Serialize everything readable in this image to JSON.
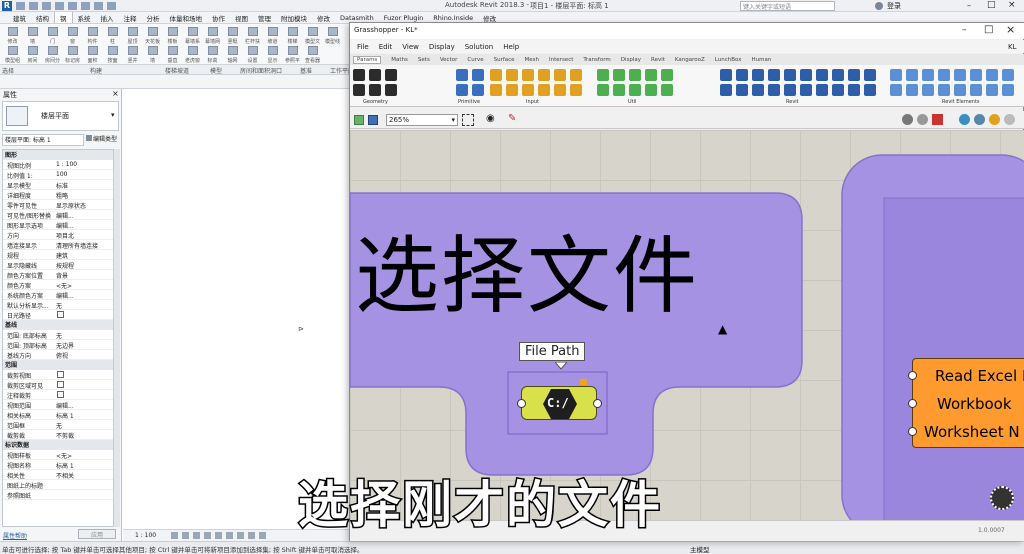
{
  "revit": {
    "app_title": "Autodesk Revit 2018.3 -",
    "doc_title": "项目1 - 楼层平面: 标高 1",
    "search_placeholder": "键入关键字或短语",
    "sign_in": "登录",
    "menu_tabs": [
      "建筑",
      "结构",
      "钢",
      "系统",
      "插入",
      "注释",
      "分析",
      "体量和场地",
      "协作",
      "视图",
      "管理",
      "附加模块",
      "修改",
      "Datasmith",
      "Fuzor Plugin",
      "Rhino.Inside",
      "修改"
    ],
    "active_tab_index": 2,
    "ribbon_tools": [
      "修改",
      "墙",
      "门",
      "窗",
      "构件",
      "柱",
      "屋顶",
      "天花板",
      "楼板",
      "幕墙系统",
      "幕墙网格",
      "竖梃",
      "栏杆扶手",
      "坡道",
      "楼梯",
      "模型文字",
      "模型线",
      "模型组",
      "房间",
      "房间分隔",
      "标记房间",
      "面积",
      "按面",
      "竖井",
      "墙",
      "垂直",
      "老虎窗",
      "标高",
      "轴网",
      "设置",
      "显示",
      "参照平面",
      "查看器"
    ],
    "ribbon_groups": [
      "选择",
      "构建",
      "楼梯坡道",
      "模型",
      "房间和面积",
      "洞口",
      "基准",
      "工作平面"
    ],
    "properties_title": "属性",
    "type_name": "楼层平面",
    "view_selector": "楼层平面: 标高 1",
    "edit_type": "编辑类型",
    "sections": [
      {
        "title": "图形",
        "rows": [
          [
            "视图比例",
            "1 : 100"
          ],
          [
            "比例值 1:",
            "100"
          ],
          [
            "显示模型",
            "标准"
          ],
          [
            "详细程度",
            "粗略"
          ],
          [
            "零件可见性",
            "显示原状态"
          ],
          [
            "可见性/图形替换",
            "编辑..."
          ],
          [
            "图形显示选项",
            "编辑..."
          ],
          [
            "方向",
            "项目北"
          ],
          [
            "墙连接显示",
            "清理所有墙连接"
          ],
          [
            "规程",
            "建筑"
          ],
          [
            "显示隐藏线",
            "按规程"
          ],
          [
            "颜色方案位置",
            "背景"
          ],
          [
            "颜色方案",
            "<无>"
          ],
          [
            "系统颜色方案",
            "编辑..."
          ],
          [
            "默认分析显示...",
            "无"
          ],
          [
            "日光路径",
            ""
          ]
        ]
      },
      {
        "title": "基线",
        "rows": [
          [
            "范围: 底部标高",
            "无"
          ],
          [
            "范围: 顶部标高",
            "无边界"
          ],
          [
            "基线方向",
            "俯视"
          ]
        ]
      },
      {
        "title": "范围",
        "rows": [
          [
            "裁剪视图",
            ""
          ],
          [
            "裁剪区域可见",
            ""
          ],
          [
            "注释裁剪",
            ""
          ],
          [
            "视图范围",
            "编辑..."
          ],
          [
            "相关标高",
            "标高 1"
          ],
          [
            "范围框",
            "无"
          ],
          [
            "截剪裁",
            "不剪裁"
          ]
        ]
      },
      {
        "title": "标识数据",
        "rows": [
          [
            "视图样板",
            "<无>"
          ],
          [
            "视图名称",
            "标高 1"
          ],
          [
            "相关性",
            "不相关"
          ],
          [
            "图纸上的标题",
            ""
          ],
          [
            "参照图纸",
            ""
          ]
        ]
      }
    ],
    "properties_help": "属性帮助",
    "apply": "应用",
    "scale_status": "1 : 100",
    "status_bar_text": "单击可进行选择; 按 Tab 键并单击可选择其他项目; 按 Ctrl 键并单击可将新项目添加到选择集; 按 Shift 键并单击可取消选择。",
    "main_model": "主模型"
  },
  "grasshopper": {
    "window_title": "Grasshopper - KL*",
    "doc_name": "KL",
    "menu": [
      "File",
      "Edit",
      "View",
      "Display",
      "Solution",
      "Help"
    ],
    "tabs": [
      "Params",
      "Maths",
      "Sets",
      "Vector",
      "Curve",
      "Surface",
      "Mesh",
      "Intersect",
      "Transform",
      "Display",
      "Revit",
      "KangarooZ",
      "LunchBox",
      "Human"
    ],
    "active_tab": "Params",
    "panel_groups": [
      "Geometry",
      "Primitive",
      "Input",
      "Util",
      "Revit",
      "Revit Elements"
    ],
    "zoom": "265%",
    "group_label": "选择文件",
    "file_path_tooltip": "File Path",
    "file_path_component": "C:/",
    "excel_component_inputs": [
      "Read Excel I",
      "Workbook",
      "Worksheet N"
    ],
    "version": "1.0.0007",
    "colors": {
      "group_fill": "#a592e3",
      "group_edge": "#8573c9",
      "canvas": "#d7d4cc",
      "component_yellow": "#d8e04a",
      "excel_orange": "#ff9a2e"
    }
  },
  "subtitle": "选择刚才的文件"
}
